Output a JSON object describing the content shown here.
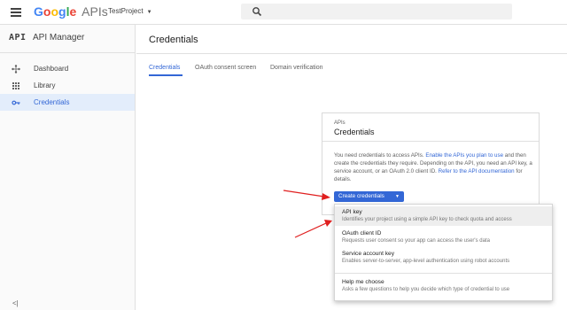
{
  "header": {
    "logo_google": "Google",
    "logo_apis": "APIs",
    "project": "TestProject",
    "search_placeholder": ""
  },
  "sidebar": {
    "title": "API Manager",
    "mark": "API",
    "items": [
      {
        "label": "Dashboard",
        "icon": "dashboard-icon",
        "active": false
      },
      {
        "label": "Library",
        "icon": "library-icon",
        "active": false
      },
      {
        "label": "Credentials",
        "icon": "key-icon",
        "active": true
      }
    ],
    "collapse_label": "<|"
  },
  "main": {
    "title": "Credentials",
    "tabs": [
      {
        "label": "Credentials",
        "active": true
      },
      {
        "label": "OAuth consent screen",
        "active": false
      },
      {
        "label": "Domain verification",
        "active": false
      }
    ]
  },
  "card": {
    "subtitle": "APIs",
    "title": "Credentials",
    "text_1": "You need credentials to access APIs. ",
    "link_1": "Enable the APIs you plan to use",
    "text_2": " and then create the credentials they require. Depending on the API, you need an API key, a service account, or an OAuth 2.0 client ID. ",
    "link_2": "Refer to the API documentation",
    "text_3": " for details.",
    "button_label": "Create credentials"
  },
  "menu": {
    "items": [
      {
        "label": "API key",
        "desc": "Identifies your project using a simple API key to check quota and access"
      },
      {
        "label": "OAuth client ID",
        "desc": "Requests user consent so your app can access the user's data"
      },
      {
        "label": "Service account key",
        "desc": "Enables server-to-server, app-level authentication using robot accounts"
      },
      {
        "label": "Help me choose",
        "desc": "Asks a few questions to help you decide which type of credential to use"
      }
    ]
  },
  "colors": {
    "accent": "#3367d6",
    "annotation_arrow": "#e02020",
    "active_nav_bg": "#e3edfb"
  }
}
